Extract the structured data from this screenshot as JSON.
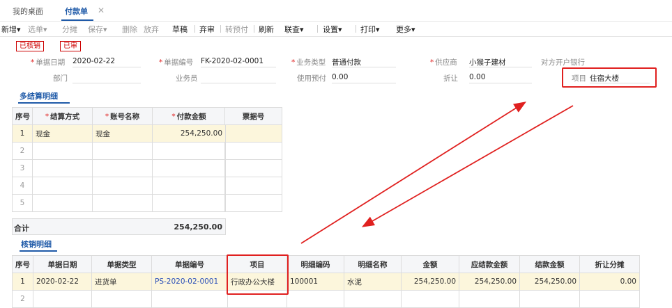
{
  "tabs": {
    "home": "我的桌面",
    "active": "付款单",
    "close": "✕"
  },
  "toolbar": {
    "new": "新增",
    "select": "选单",
    "split": "分摊",
    "save": "保存",
    "delete": "删除",
    "discard": "放弃",
    "draft": "草稿",
    "unaudit": "弃审",
    "prepay": "转预付",
    "refresh": "刷新",
    "link": "联查",
    "settings": "设置",
    "print": "打印",
    "more": "更多",
    "caret": "▾"
  },
  "status": {
    "verified": "已核销",
    "audited": "已审"
  },
  "form": {
    "date_label": "单据日期",
    "date": "2020-02-22",
    "no_label": "单据编号",
    "no": "FK-2020-02-0001",
    "type_label": "业务类型",
    "type": "普通付款",
    "supplier_label": "供应商",
    "supplier": "小猴子建材",
    "bank_label": "对方开户银行",
    "dept_label": "部门",
    "dept": "",
    "staff_label": "业务员",
    "staff": "",
    "prepay_label": "使用预付",
    "prepay": "0.00",
    "discount_label": "折让",
    "discount": "0.00",
    "project_label": "项目",
    "project": "住宿大楼"
  },
  "settlement": {
    "title": "多结算明细",
    "headers": [
      "序号",
      "结算方式",
      "账号名称",
      "付款金额",
      "票据号"
    ],
    "rows": [
      [
        "1",
        "现金",
        "现金",
        "254,250.00",
        ""
      ],
      [
        "2",
        "",
        "",
        "",
        ""
      ],
      [
        "3",
        "",
        "",
        "",
        ""
      ],
      [
        "4",
        "",
        "",
        "",
        ""
      ],
      [
        "5",
        "",
        "",
        "",
        ""
      ]
    ],
    "total_label": "合计",
    "total": "254,250.00"
  },
  "writeoff": {
    "title": "核销明细",
    "headers": [
      "序号",
      "单据日期",
      "单据类型",
      "单据编号",
      "项目",
      "明细编码",
      "明细名称",
      "金额",
      "应结款金额",
      "结款金额",
      "折让分摊"
    ],
    "rows": [
      [
        "1",
        "2020-02-22",
        "进货单",
        "PS-2020-02-0001",
        "行政办公大楼",
        "100001",
        "水泥",
        "254,250.00",
        "254,250.00",
        "254,250.00",
        "0.00"
      ],
      [
        "2",
        "",
        "",
        "",
        "",
        "",
        "",
        "",
        "",
        "",
        ""
      ]
    ]
  },
  "colors": {
    "accent": "#1f5aa8",
    "annotation": "#e0201f",
    "selected_row": "#fcf6dc"
  }
}
